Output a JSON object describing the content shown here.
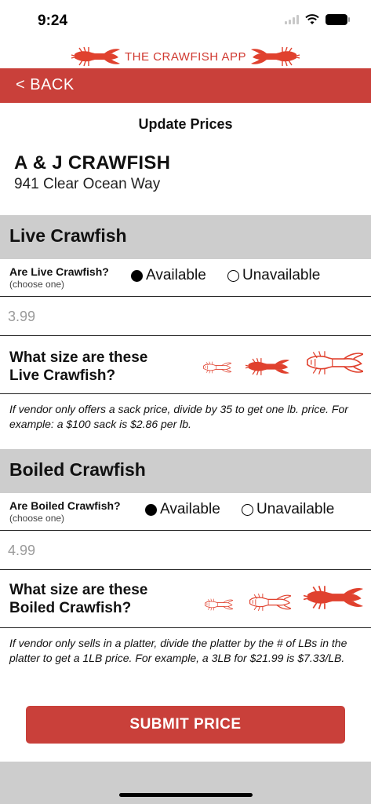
{
  "status": {
    "time": "9:24"
  },
  "brand": {
    "title": "THE CRAWFISH APP"
  },
  "nav": {
    "back_label": "< BACK"
  },
  "page": {
    "title": "Update Prices"
  },
  "vendor": {
    "name": "A & J CRAWFISH",
    "address": "941 Clear Ocean Way"
  },
  "live": {
    "header": "Live Crawfish",
    "question": "Are Live Crawfish?",
    "hint": "(choose one)",
    "available_label": "Available",
    "unavailable_label": "Unavailable",
    "selected": "available",
    "price_value": "3.99",
    "size_question_line1": "What size are these",
    "size_question_line2": "Live Crawfish?",
    "selected_size": "medium",
    "note": "If vendor only offers a sack price, divide by 35 to get one lb. price. For example: a $100 sack is $2.86 per lb."
  },
  "boiled": {
    "header": "Boiled Crawfish",
    "question": "Are Boiled Crawfish?",
    "hint": "(choose one)",
    "available_label": "Available",
    "unavailable_label": "Unavailable",
    "selected": "available",
    "price_value": "4.99",
    "size_question_line1": "What size are these",
    "size_question_line2": "Boiled Crawfish?",
    "selected_size": "large",
    "note": "If vendor only sells in a platter, divide the platter by the # of LBs in the platter to get a 1LB price. For example, a 3LB for $21.99 is $7.33/LB."
  },
  "submit": {
    "label": "SUBMIT PRICE"
  },
  "colors": {
    "accent": "#c9403a",
    "section_bg": "#cdcdcd",
    "crawfish": "#e0412e"
  }
}
